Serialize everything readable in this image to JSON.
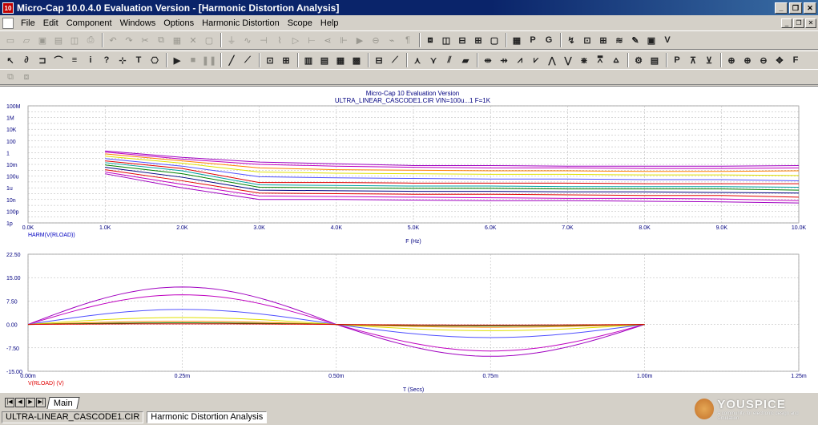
{
  "window": {
    "title": "Micro-Cap 10.0.4.0 Evaluation Version - [Harmonic Distortion Analysis]",
    "icon_label": "10"
  },
  "menu": [
    "File",
    "Edit",
    "Component",
    "Windows",
    "Options",
    "Harmonic Distortion",
    "Scope",
    "Help"
  ],
  "plot_header": {
    "line1": "Micro-Cap 10 Evaluation Version",
    "line2": "ULTRA_LINEAR_CASCODE1.CIR VIN=100u...1  F=1K"
  },
  "tabs": {
    "main": "Main"
  },
  "status": {
    "file": "ULTRA-LINEAR_CASCODE1.CIR",
    "window": "Harmonic Distortion Analysis"
  },
  "watermark": {
    "brand": "YOUSPICE",
    "tagline": "A community for electronic design and simulation"
  },
  "colors": {
    "purple": "#a000c0",
    "magenta": "#c000c0",
    "blue": "#5050ff",
    "yellow": "#e0e000",
    "orange": "#ff8000",
    "red": "#e00000",
    "green": "#008000",
    "navy": "#000080",
    "teal": "#00a0a0"
  },
  "chart_data": [
    {
      "type": "line",
      "title": "",
      "xlabel": "F (Hz)",
      "ylabel": "HARM(V(RLOAD))",
      "x_ticks": [
        "0.0K",
        "1.0K",
        "2.0K",
        "3.0K",
        "4.0K",
        "5.0K",
        "6.0K",
        "7.0K",
        "8.0K",
        "9.0K",
        "10.0K"
      ],
      "y_ticks": [
        "100M",
        "1M",
        "10K",
        "100",
        "1",
        "10m",
        "100u",
        "1u",
        "10n",
        "100p",
        "1p"
      ],
      "y_scale": "log",
      "xlim": [
        0,
        10000
      ],
      "ylim_exp": [
        -12,
        8
      ],
      "x": [
        1000,
        2000,
        3000,
        4000,
        5000,
        6000,
        7000,
        8000,
        9000,
        10000
      ],
      "series": [
        {
          "color": "purple",
          "log10_values": [
            0.3,
            -0.8,
            -1.6,
            -1.9,
            -2.2,
            -2.2,
            -2.3,
            -2.3,
            -2.3,
            -2.2
          ]
        },
        {
          "color": "magenta",
          "log10_values": [
            0.1,
            -1.1,
            -2.0,
            -2.3,
            -2.5,
            -2.6,
            -2.6,
            -2.7,
            -2.7,
            -2.6
          ]
        },
        {
          "color": "orange",
          "log10_values": [
            -0.2,
            -1.4,
            -2.6,
            -2.9,
            -3.0,
            -3.1,
            -3.1,
            -3.2,
            -3.2,
            -3.1
          ]
        },
        {
          "color": "yellow",
          "log10_values": [
            -0.6,
            -1.8,
            -3.3,
            -3.5,
            -3.6,
            -3.7,
            -3.7,
            -3.8,
            -3.8,
            -3.9
          ]
        },
        {
          "color": "blue",
          "log10_values": [
            -1.0,
            -2.3,
            -4.1,
            -4.3,
            -4.4,
            -4.5,
            -4.5,
            -4.6,
            -4.6,
            -4.8
          ]
        },
        {
          "color": "red",
          "log10_values": [
            -1.4,
            -2.7,
            -5.1,
            -5.1,
            -5.2,
            -5.2,
            -5.2,
            -5.3,
            -5.3,
            -5.3
          ]
        },
        {
          "color": "teal",
          "log10_values": [
            -1.7,
            -3.1,
            -5.5,
            -5.6,
            -5.7,
            -5.7,
            -5.8,
            -5.8,
            -5.8,
            -5.9
          ]
        },
        {
          "color": "green",
          "log10_values": [
            -2.1,
            -3.6,
            -5.9,
            -6.0,
            -6.1,
            -6.1,
            -6.2,
            -6.2,
            -6.2,
            -6.4
          ]
        },
        {
          "color": "navy",
          "log10_values": [
            -2.5,
            -4.2,
            -6.4,
            -6.5,
            -6.6,
            -6.6,
            -6.7,
            -6.7,
            -6.8,
            -6.9
          ]
        },
        {
          "color": "red",
          "log10_values": [
            -2.9,
            -4.8,
            -6.9,
            -7.0,
            -7.1,
            -7.1,
            -7.2,
            -7.3,
            -7.3,
            -7.6
          ]
        },
        {
          "color": "magenta",
          "log10_values": [
            -3.3,
            -5.4,
            -7.4,
            -7.5,
            -7.6,
            -7.7,
            -7.8,
            -7.8,
            -7.9,
            -8.2
          ]
        },
        {
          "color": "purple",
          "log10_values": [
            -3.6,
            -6.0,
            -8.0,
            -8.0,
            -8.1,
            -8.2,
            -8.2,
            -8.3,
            -8.4,
            -8.6
          ]
        }
      ]
    },
    {
      "type": "line",
      "title": "",
      "xlabel": "T (Secs)",
      "ylabel": "V(RLOAD) (V)",
      "x_ticks": [
        "0.00m",
        "0.25m",
        "0.50m",
        "0.75m",
        "1.00m",
        "1.25m"
      ],
      "y_ticks": [
        "22.50",
        "15.00",
        "7.50",
        "0.00",
        "-7.50",
        "-15.00"
      ],
      "xlim": [
        0,
        1.25
      ],
      "ylim": [
        -15,
        22.5
      ],
      "period_ms": 1.0,
      "series": [
        {
          "color": "purple",
          "amplitude": 12.0,
          "neg_amplitude": 10.2
        },
        {
          "color": "magenta",
          "amplitude": 9.5,
          "neg_amplitude": 8.5
        },
        {
          "color": "blue",
          "amplitude": 4.8,
          "neg_amplitude": 4.2
        },
        {
          "color": "yellow",
          "amplitude": 2.2,
          "neg_amplitude": 2.0
        },
        {
          "color": "orange",
          "amplitude": 1.0,
          "neg_amplitude": 0.9
        },
        {
          "color": "green",
          "amplitude": 0.5,
          "neg_amplitude": 0.45
        },
        {
          "color": "red",
          "amplitude": 0.2,
          "neg_amplitude": 0.2
        }
      ]
    }
  ]
}
